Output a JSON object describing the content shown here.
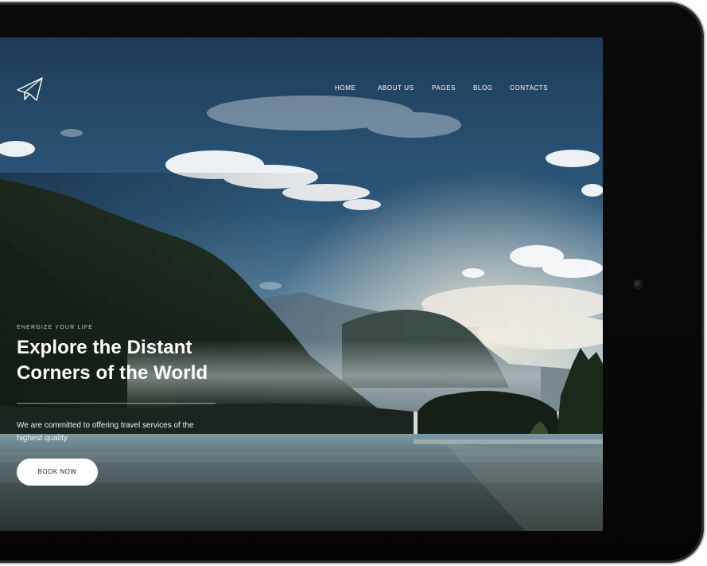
{
  "logo": {
    "icon": "paper-plane-icon"
  },
  "nav": {
    "items": [
      {
        "label": "HOME"
      },
      {
        "label": "ABOUT US"
      },
      {
        "label": "PAGES"
      },
      {
        "label": "BLOG"
      },
      {
        "label": "CONTACTS"
      }
    ]
  },
  "hero": {
    "eyebrow": "ENERGIZE YOUR LIFE",
    "title_line1": "Explore the Distant",
    "title_line2": "Corners of the World",
    "tagline_line1": "We are committed to offering travel services of the",
    "tagline_line2": "highest quality",
    "cta_label": "BOOK NOW"
  },
  "colors": {
    "device_frame": "#0b0b0b",
    "sky_top": "#1f3e5c",
    "sky_bottom": "#8fb2c6",
    "mountain": "#1f2d20",
    "lake": "#4a5a5e",
    "button_bg": "#ffffff",
    "button_text": "#1b1b1b",
    "text": "#ffffff"
  }
}
